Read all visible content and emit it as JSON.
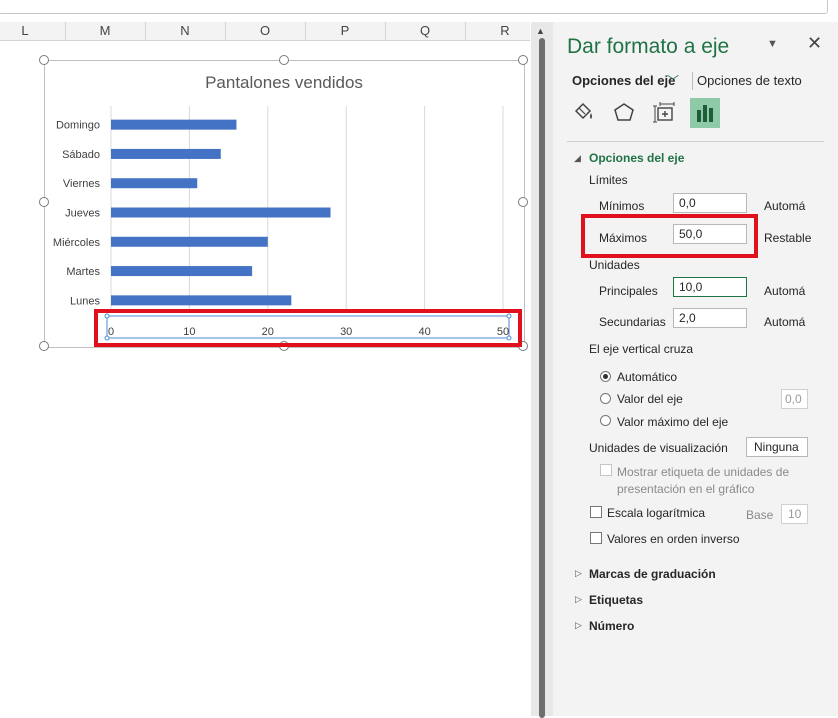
{
  "columns": [
    "L",
    "M",
    "N",
    "O",
    "P",
    "Q",
    "R"
  ],
  "chart_data": {
    "type": "bar",
    "title": "Pantalones vendidos",
    "categories": [
      "Domingo",
      "Sábado",
      "Viernes",
      "Jueves",
      "Miércoles",
      "Martes",
      "Lunes"
    ],
    "values": [
      16,
      14,
      11,
      28,
      20,
      18,
      23
    ],
    "xlim": [
      0,
      50
    ],
    "xticks": [
      "0",
      "10",
      "20",
      "30",
      "40",
      "50"
    ],
    "grid": true,
    "bar_color": "#4472c4",
    "highlight_color": "#e0101d"
  },
  "pane": {
    "title": "Dar formato a eje",
    "tab_axis": "Opciones del eje",
    "tab_text": "Opciones de texto",
    "icons": [
      "fill-line-icon",
      "effects-pentagon-icon",
      "size-properties-icon",
      "axis-options-icon"
    ],
    "section_axis": "Opciones del eje",
    "limits_label": "Límites",
    "min_label": "Mínimos",
    "min_value": "0,0",
    "min_auto": "Automá",
    "max_label": "Máximos",
    "max_value": "50,0",
    "max_reset": "Restable",
    "units_label": "Unidades",
    "major_label": "Principales",
    "major_value": "10,0",
    "major_auto": "Automá",
    "minor_label": "Secundarias",
    "minor_value": "2,0",
    "minor_auto": "Automá",
    "crosses_label": "El eje vertical cruza",
    "cross_auto": "Automático",
    "cross_value": "Valor del eje",
    "cross_value_input": "0,0",
    "cross_max": "Valor máximo del eje",
    "display_units_label": "Unidades de visualización",
    "display_units_value": "Ninguna",
    "show_units_label_1": "Mostrar etiqueta de unidades de",
    "show_units_label_2": "presentación en el gráfico",
    "log_scale": "Escala logarítmica",
    "base_label": "Base",
    "base_value": "10",
    "reverse": "Valores en orden inverso",
    "section_ticks": "Marcas de graduación",
    "section_labels": "Etiquetas",
    "section_number": "Número"
  }
}
